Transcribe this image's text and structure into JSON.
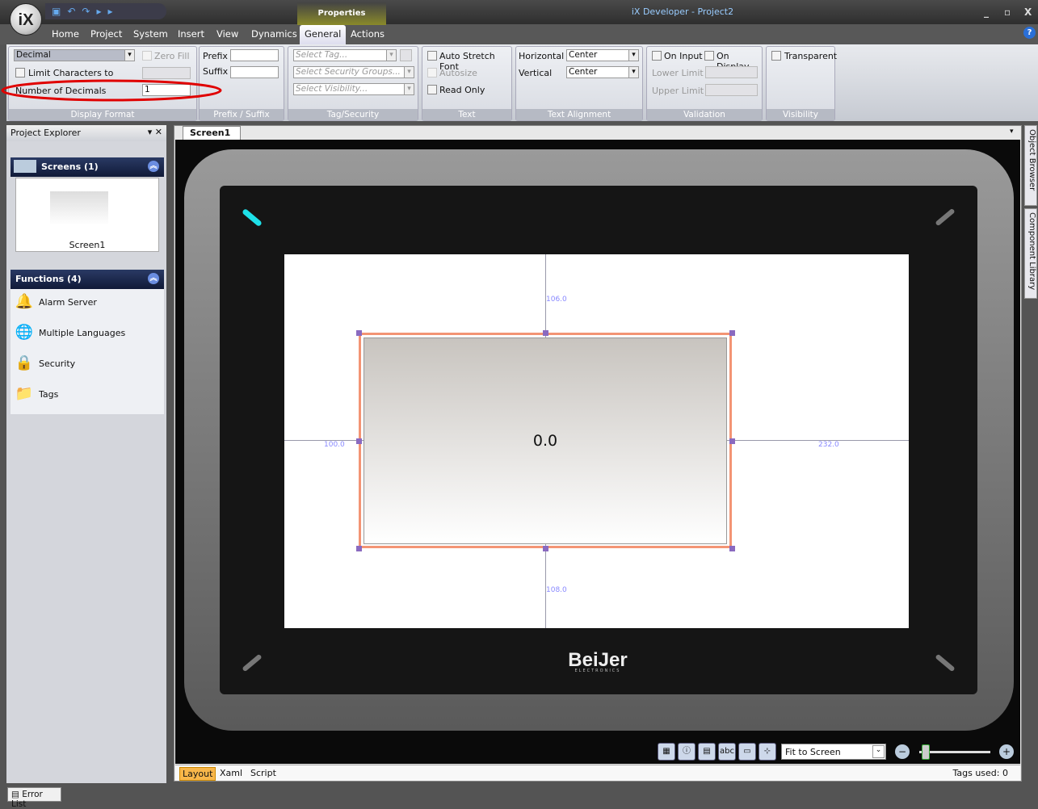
{
  "window": {
    "title": "iX Developer - Project2",
    "logo": "iX",
    "context_tab": "Properties",
    "min": "_",
    "max": "▫",
    "close": "X",
    "help": "?"
  },
  "menu_tabs": [
    "Home",
    "Project",
    "System",
    "Insert",
    "View",
    "Dynamics",
    "General",
    "Actions"
  ],
  "active_tab": "General",
  "ribbon": {
    "display_format": {
      "label": "Display Format",
      "format": "Decimal",
      "zero_fill": "Zero Fill",
      "limit_chars": "Limit Characters to",
      "num_decimals_label": "Number of Decimals",
      "num_decimals": "1"
    },
    "prefix_suffix": {
      "label": "Prefix / Suffix",
      "prefix": "Prefix",
      "suffix": "Suffix"
    },
    "tag_security": {
      "label": "Tag/Security",
      "tag": "Select Tag...",
      "security": "Select Security Groups...",
      "visibility": "Select Visibility..."
    },
    "text": {
      "label": "Text",
      "auto_stretch": "Auto Stretch Font",
      "autosize": "Autosize",
      "read_only": "Read Only"
    },
    "text_alignment": {
      "label": "Text Alignment",
      "horizontal": "Horizontal",
      "horizontal_value": "Center",
      "vertical": "Vertical",
      "vertical_value": "Center"
    },
    "validation": {
      "label": "Validation",
      "on_input": "On Input",
      "on_display": "On Display",
      "lower": "Lower Limit",
      "upper": "Upper Limit"
    },
    "visibility": {
      "label": "Visibility",
      "transparent": "Transparent"
    }
  },
  "project_explorer": {
    "title": "Project Explorer",
    "screens_header": "Screens (1)",
    "screen_name": "Screen1",
    "functions_header": "Functions (4)",
    "functions": [
      {
        "label": "Alarm Server",
        "icon": "bell-icon"
      },
      {
        "label": "Multiple Languages",
        "icon": "globe-icon"
      },
      {
        "label": "Security",
        "icon": "lock-icon"
      },
      {
        "label": "Tags",
        "icon": "folder-icon"
      }
    ]
  },
  "editor": {
    "tab": "Screen1",
    "object_value": "0.0",
    "guide_top": "106.0",
    "guide_left": "100.0",
    "guide_right": "232.0",
    "guide_bottom": "108.0",
    "brand": "BeiJer",
    "brand_sub": "ELECTRONICS",
    "zoom_mode": "Fit to Screen",
    "zoom_level": 0.1,
    "tabs": [
      "Layout",
      "Xaml",
      "Script"
    ],
    "active_view": "Layout",
    "tags_used": "Tags used: 0"
  },
  "side_tabs": [
    "Object Browser",
    "Component Library"
  ],
  "error_list": "Error List",
  "colors": {
    "selection": "#f39474",
    "accent_led": "#1ee0e8",
    "highlight_ellipse": "#e00000"
  }
}
